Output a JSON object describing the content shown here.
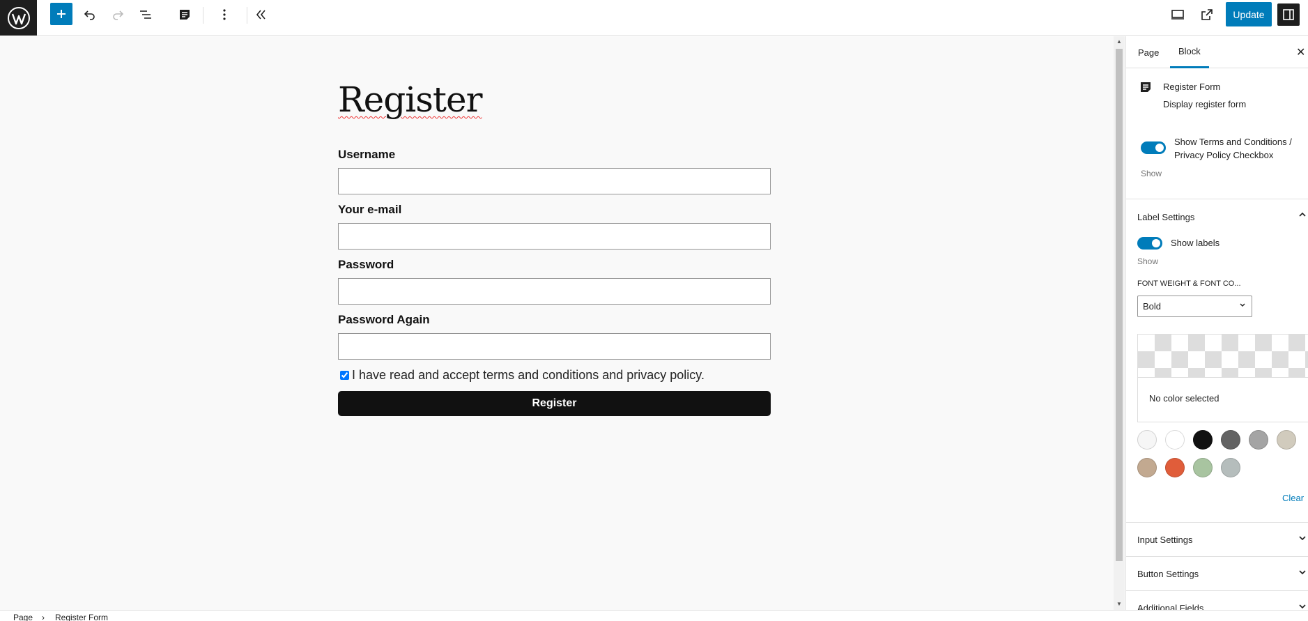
{
  "toolbar": {
    "add_icon": "plus-icon",
    "undo_icon": "undo-icon",
    "redo_icon": "redo-icon",
    "list_view_icon": "list-view-icon",
    "block_icon": "document-icon",
    "options_icon": "more-vertical-icon",
    "collapse_icon": "chevron-double-left-icon",
    "preview_icon": "desktop-icon",
    "external_icon": "external-link-icon",
    "update_label": "Update",
    "settings_icon": "sidebar-icon"
  },
  "canvas": {
    "title": "Register",
    "fields": [
      {
        "label": "Username"
      },
      {
        "label": "Your e-mail"
      },
      {
        "label": "Password"
      },
      {
        "label": "Password Again"
      }
    ],
    "terms_text": "I have read and accept terms and conditions and privacy policy.",
    "terms_checked": true,
    "button_label": "Register"
  },
  "breadcrumb": {
    "items": [
      "Page",
      "Register Form"
    ],
    "separator": "›"
  },
  "sidebar": {
    "tabs": [
      {
        "label": "Page",
        "active": false
      },
      {
        "label": "Block",
        "active": true
      }
    ],
    "block": {
      "title": "Register Form",
      "description": "Display register form"
    },
    "terms_toggle": {
      "label_line1": "Show Terms and Conditions /",
      "label_line2": "Privacy Policy Checkbox",
      "help": "Show",
      "on": true
    },
    "label_settings": {
      "title": "Label Settings",
      "show_labels": "Show labels",
      "help": "Show",
      "font_label": "FONT WEIGHT & FONT CO...",
      "font_value": "Bold",
      "no_color": "No color selected",
      "clear": "Clear"
    },
    "palette": [
      "#f6f6f6",
      "#ffffff",
      "#111111",
      "#636363",
      "#a4a4a4",
      "#d1cbbd",
      "#c2a990",
      "#e05d3a",
      "#a8c4a0",
      "#b5bdbc"
    ],
    "panels": [
      {
        "title": "Input Settings"
      },
      {
        "title": "Button Settings"
      },
      {
        "title": "Additional Fields"
      }
    ]
  },
  "colors": {
    "accent": "#007cba",
    "dark": "#1e1e1e"
  }
}
